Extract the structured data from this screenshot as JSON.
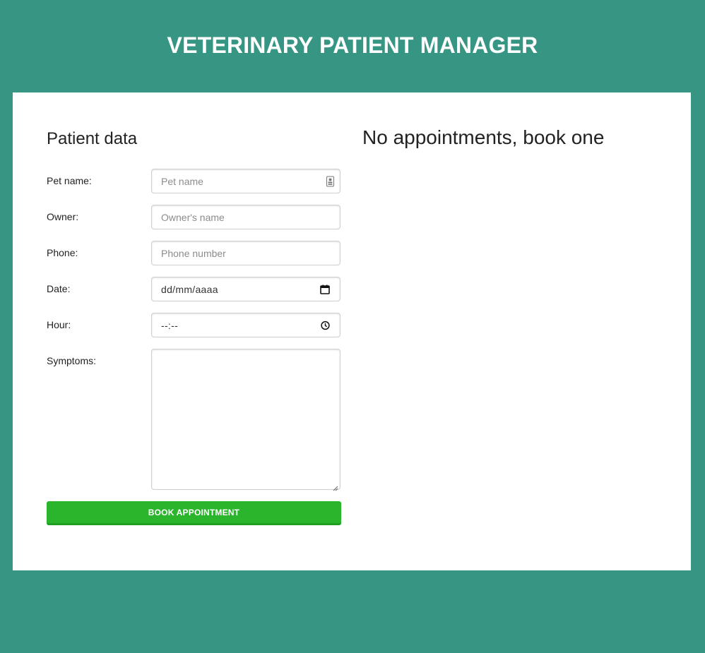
{
  "app": {
    "title": "VETERINARY PATIENT MANAGER"
  },
  "form": {
    "title": "Patient data",
    "fields": {
      "pet": {
        "label": "Pet name:",
        "placeholder": "Pet name"
      },
      "owner": {
        "label": "Owner:",
        "placeholder": "Owner's name"
      },
      "phone": {
        "label": "Phone:",
        "placeholder": "Phone number"
      },
      "date": {
        "label": "Date:",
        "value": "dd/mm/aaaa"
      },
      "hour": {
        "label": "Hour:",
        "value": "--:--"
      },
      "symptoms": {
        "label": "Symptoms:",
        "value": ""
      }
    },
    "submit_label": "BOOK APPOINTMENT"
  },
  "appointments": {
    "empty_message": "No appointments, book one"
  },
  "colors": {
    "background": "#379683",
    "button": "#2bb52d"
  },
  "icons": {
    "pet_input": "contact-card-icon",
    "date_input": "calendar-icon",
    "hour_input": "clock-icon"
  }
}
